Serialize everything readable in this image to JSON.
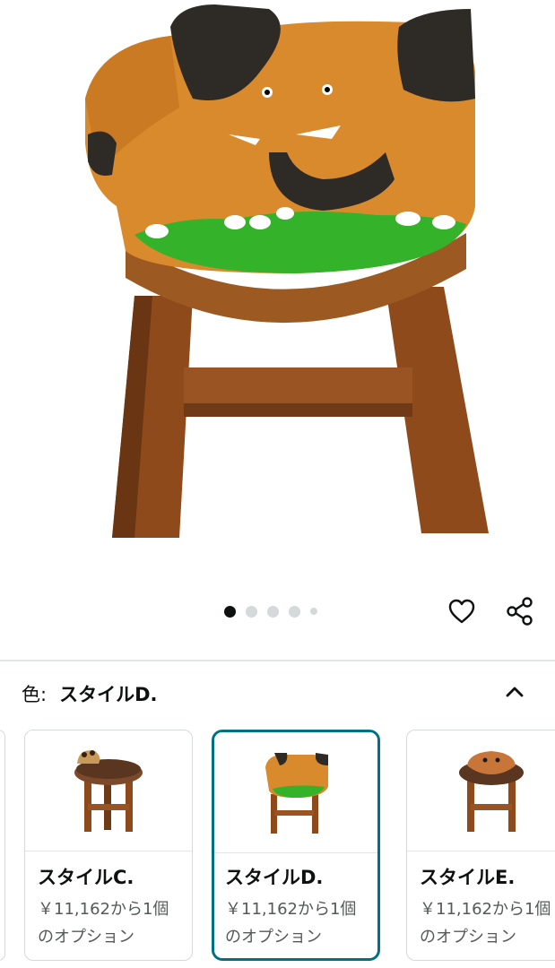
{
  "carousel": {
    "total_images": 5,
    "active_index": 0
  },
  "actions": {
    "favorite_icon": "heart-outline-icon",
    "share_icon": "share-icon"
  },
  "variation": {
    "label": "色:",
    "selected_value": "スタイルD.",
    "collapse_icon": "chevron-up-icon"
  },
  "options": [
    {
      "name": "スタイルC.",
      "price_line1": "￥11,162から1個",
      "price_line2": "のオプション",
      "selected": false,
      "thumb": "giraffe-stool"
    },
    {
      "name": "スタイルD.",
      "price_line1": "￥11,162から1個",
      "price_line2": "のオプション",
      "selected": true,
      "thumb": "elephant-stool"
    },
    {
      "name": "スタイルE.",
      "price_line1": "￥11,162から1個",
      "price_line2": "のオプション",
      "selected": false,
      "thumb": "tiger-stool"
    }
  ],
  "colors": {
    "accent_selected": "#007185",
    "text": "#0f1111",
    "muted": "#565959"
  }
}
